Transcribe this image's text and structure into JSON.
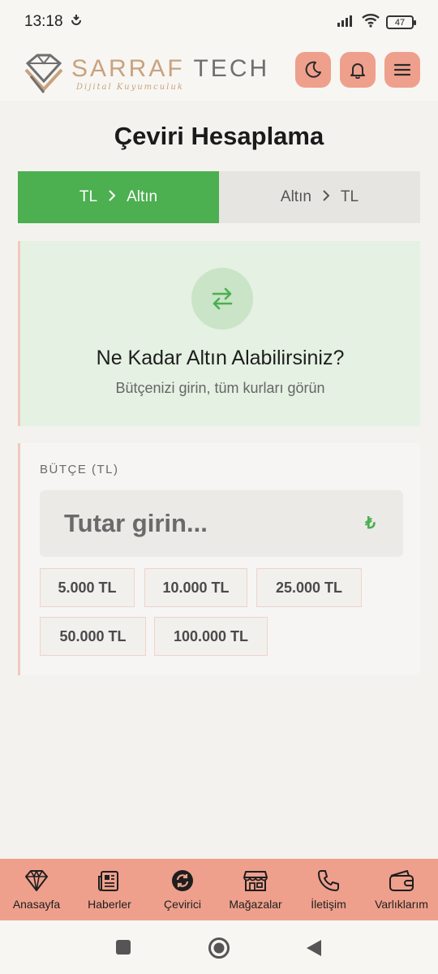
{
  "status": {
    "time": "13:18",
    "battery": "47"
  },
  "header": {
    "logo_brand": "SARRAF",
    "logo_brand2": "TECH",
    "logo_tagline": "Dijital Kuyumculuk",
    "icons": [
      "moon-icon",
      "bell-icon",
      "menu-icon"
    ]
  },
  "page": {
    "title": "Çeviri Hesaplama"
  },
  "tabs": [
    {
      "from": "TL",
      "to": "Altın",
      "active": true
    },
    {
      "from": "Altın",
      "to": "TL",
      "active": false
    }
  ],
  "hero": {
    "icon": "swap-arrows-icon",
    "title": "Ne Kadar Altın Alabilirsiniz?",
    "subtitle": "Bütçenizi girin, tüm kurları görün"
  },
  "budget": {
    "label": "BÜTÇE (TL)",
    "placeholder": "Tutar girin...",
    "value": "",
    "currency_symbol": "₺",
    "presets": [
      "5.000 TL",
      "10.000 TL",
      "25.000 TL",
      "50.000 TL",
      "100.000 TL"
    ]
  },
  "bottom_nav": [
    {
      "label": "Anasayfa",
      "icon": "diamond-icon"
    },
    {
      "label": "Haberler",
      "icon": "newspaper-icon"
    },
    {
      "label": "Çevirici",
      "icon": "converter-icon"
    },
    {
      "label": "Mağazalar",
      "icon": "store-icon"
    },
    {
      "label": "İletişim",
      "icon": "phone-icon"
    },
    {
      "label": "Varlıklarım",
      "icon": "wallet-icon"
    }
  ],
  "colors": {
    "accent_green": "#4caf50",
    "accent_salmon": "#eea08c",
    "gold": "#c9a27e"
  }
}
